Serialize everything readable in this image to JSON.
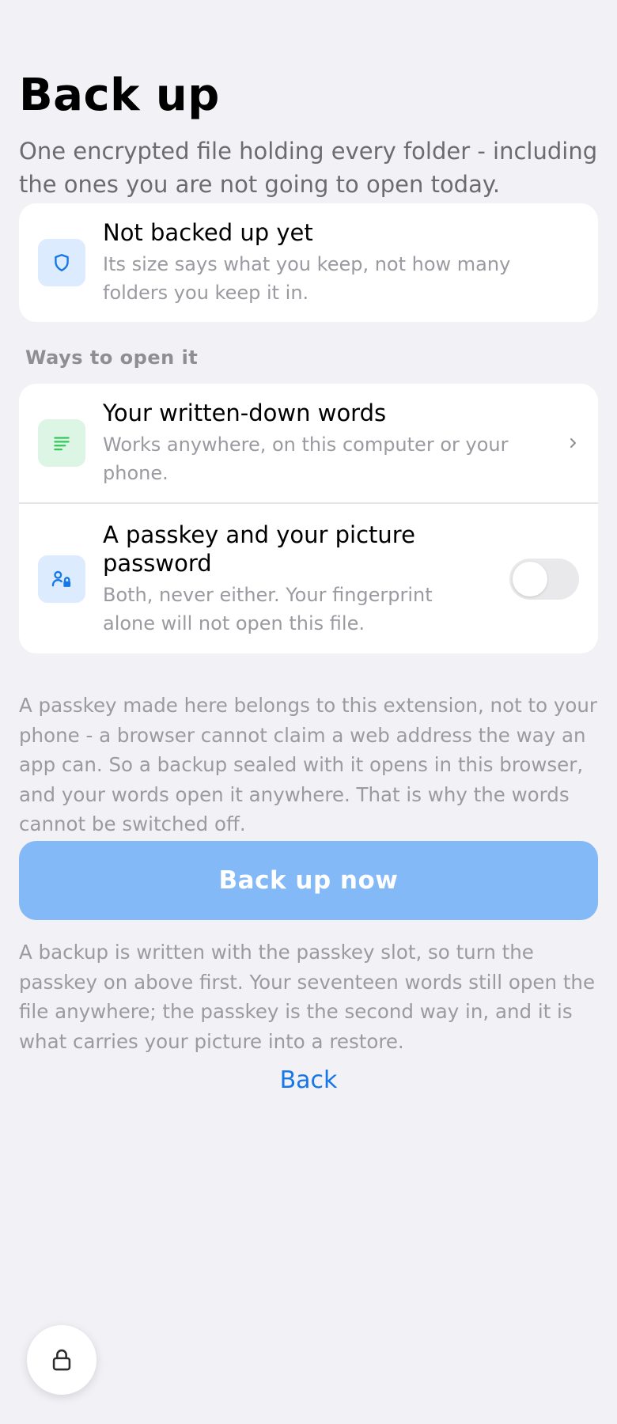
{
  "header": {
    "title": "Back up",
    "subtitle": "One encrypted file holding every folder - including the ones you are not going to open today."
  },
  "status_card": {
    "icon": "shield-icon",
    "title": "Not backed up yet",
    "description": "Its size says what you keep, not how many folders you keep it in."
  },
  "ways": {
    "section_label": "Ways to open it",
    "words": {
      "icon": "text-lines-icon",
      "title": "Your written-down words",
      "description": "Works anywhere, on this computer or your phone."
    },
    "passkey": {
      "icon": "person-lock-icon",
      "title": "A passkey and your picture password",
      "description": "Both, never either. Your fingerprint alone will not open this file.",
      "toggle_on": false
    }
  },
  "passkey_note": "A passkey made here belongs to this extension, not to your phone - a browser cannot claim a web address the way an app can. So a backup sealed with it opens in this browser, and your words open it anywhere. That is why the words cannot be switched off.",
  "primary_button": {
    "label": "Back up now",
    "disabled": true
  },
  "backup_note": "A backup is written with the passkey slot, so turn the passkey on above first. Your seventeen words still open the file anywhere; the passkey is the second way in, and it is what carries your picture into a restore.",
  "back_link": "Back",
  "lock_button": {
    "icon": "lock-icon"
  },
  "colors": {
    "accent": "#1577e8",
    "button_disabled": "#84b9f8",
    "background": "#f1f1f6",
    "green": "#34c759"
  }
}
